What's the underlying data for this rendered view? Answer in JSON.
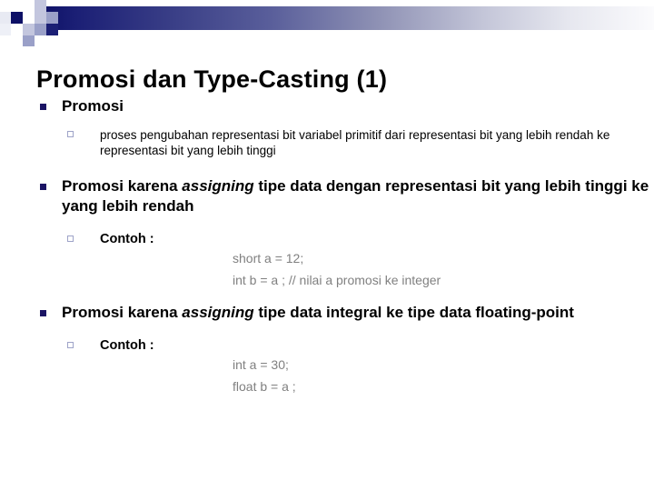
{
  "slide": {
    "title": "Promosi dan Type-Casting (1)",
    "decoration": {
      "bar_gradient_start": "#0d1066",
      "bar_gradient_end": "#fbfbfd",
      "accent_navy": "#1b1464",
      "accent_light": "#9ea3c8"
    },
    "bullets": [
      {
        "level1": "Promosi",
        "sub": [
          "proses pengubahan representasi bit variabel primitif dari representasi bit yang lebih rendah ke representasi bit yang lebih tinggi"
        ]
      },
      {
        "level1_parts": {
          "a": "Promosi karena ",
          "italic": "assigning",
          "b": " tipe data dengan representasi bit yang lebih tinggi ke yang lebih rendah"
        },
        "contoh_label": "Contoh :",
        "code": [
          "short a = 12;",
          "int b = a ; // nilai a promosi ke integer"
        ]
      },
      {
        "level1_parts": {
          "a": "Promosi karena ",
          "italic": "assigning",
          "b": " tipe data integral ke tipe data floating-point"
        },
        "contoh_label": "Contoh :",
        "code": [
          "int a = 30;",
          "float b = a ;"
        ]
      }
    ]
  },
  "code_color": "#808080"
}
